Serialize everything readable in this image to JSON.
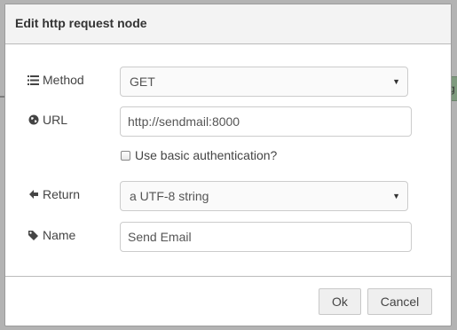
{
  "background": {
    "node_fragment_text": "g"
  },
  "dialog": {
    "title": "Edit http request node",
    "fields": {
      "method": {
        "label": "Method",
        "icon": "list-icon",
        "value": "GET"
      },
      "url": {
        "label": "URL",
        "icon": "globe-icon",
        "value": "http://sendmail:8000"
      },
      "basic_auth": {
        "label": "Use basic authentication?",
        "checked": false
      },
      "return": {
        "label": "Return",
        "icon": "arrow-left-icon",
        "value": "a UTF-8 string"
      },
      "name": {
        "label": "Name",
        "icon": "tag-icon",
        "value": "Send Email"
      }
    },
    "buttons": {
      "ok": "Ok",
      "cancel": "Cancel"
    }
  },
  "colors": {
    "title_bar": "#f3f3f3",
    "canvas": "#b3b3b3",
    "node_fill": "#7e9a7e"
  }
}
